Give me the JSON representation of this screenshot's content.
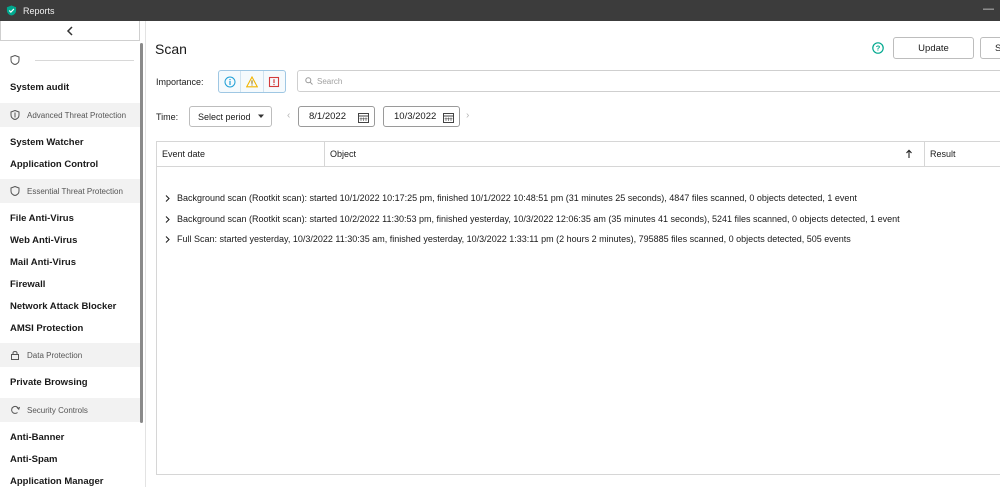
{
  "window": {
    "title": "Reports",
    "minimize": "—"
  },
  "sidebar": {
    "groups": [
      {
        "label": "",
        "icon": "shield-icon"
      },
      {
        "label": "Advanced Threat Protection",
        "icon": "shield-icon"
      },
      {
        "label": "Essential Threat Protection",
        "icon": "shield-icon"
      },
      {
        "label": "Data Protection",
        "icon": "lock-icon"
      },
      {
        "label": "Security Controls",
        "icon": "security-controls-icon"
      }
    ],
    "items": [
      {
        "label": "System audit"
      },
      {
        "label": "System Watcher"
      },
      {
        "label": "Application Control"
      },
      {
        "label": "File Anti-Virus"
      },
      {
        "label": "Web Anti-Virus"
      },
      {
        "label": "Mail Anti-Virus"
      },
      {
        "label": "Firewall"
      },
      {
        "label": "Network Attack Blocker"
      },
      {
        "label": "AMSI Protection"
      },
      {
        "label": "Private Browsing"
      },
      {
        "label": "Anti-Banner"
      },
      {
        "label": "Anti-Spam"
      },
      {
        "label": "Application Manager"
      }
    ]
  },
  "main": {
    "title": "Scan",
    "buttons": {
      "update": "Update",
      "second": "S"
    },
    "filters": {
      "importance_label": "Importance:",
      "search_placeholder": "Search",
      "time_label": "Time:",
      "period": "Select period",
      "date_from": "8/1/2022",
      "date_to": "10/3/2022"
    },
    "table": {
      "columns": [
        "Event date",
        "Object",
        "Result"
      ],
      "rows": [
        "Background scan (Rootkit scan): started 10/1/2022 10:17:25 pm, finished 10/1/2022 10:48:51 pm (31 minutes 25 seconds), 4847 files scanned, 0 objects detected, 1 event",
        "Background scan (Rootkit scan): started 10/2/2022 11:30:53 pm, finished yesterday, 10/3/2022 12:06:35 am (35 minutes 41 seconds), 5241 files scanned, 0 objects detected, 1 event",
        "Full Scan: started yesterday, 10/3/2022 11:30:35 am, finished yesterday, 10/3/2022 1:33:11 pm (2 hours 2 minutes), 795885 files scanned, 0 objects detected, 505 events"
      ]
    }
  },
  "colors": {
    "titlebar": "#3c3c3c",
    "accent": "#1e9fd6",
    "warning": "#f1b400",
    "critical": "#d23c3c",
    "brand": "#00a88e"
  }
}
